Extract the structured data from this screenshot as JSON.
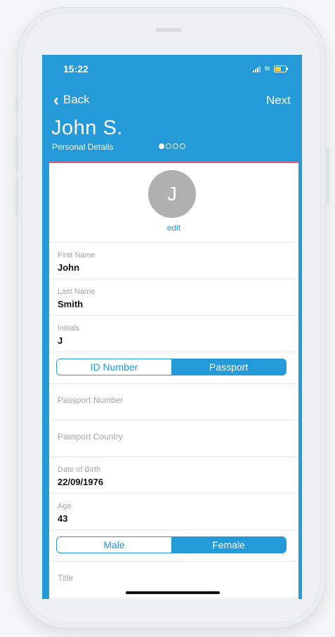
{
  "status": {
    "time": "15:22"
  },
  "nav": {
    "back_label": "Back",
    "next_label": "Next"
  },
  "header": {
    "title": "John S.",
    "subtitle": "Personal Details",
    "step_index": 1,
    "step_count": 4
  },
  "avatar": {
    "initial": "J",
    "edit_label": "edit"
  },
  "fields": {
    "first_name": {
      "label": "First Name",
      "value": "John"
    },
    "last_name": {
      "label": "Last Name",
      "value": "Smith"
    },
    "initials": {
      "label": "Initials",
      "value": "J"
    },
    "passport_number": {
      "label": "Passport Number",
      "value": ""
    },
    "passport_country": {
      "label": "Passport Country",
      "value": ""
    },
    "date_of_birth": {
      "label": "Date of Birth",
      "value": "22/09/1976"
    },
    "age": {
      "label": "Age",
      "value": "43"
    },
    "title": {
      "label": "Title",
      "value": ""
    }
  },
  "id_type": {
    "options": [
      "ID Number",
      "Passport"
    ],
    "selected": "Passport"
  },
  "gender": {
    "options": [
      "Male",
      "Female"
    ],
    "selected": "Female"
  },
  "colors": {
    "primary": "#259ad9",
    "accent_line": "#e85a7a",
    "avatar_bg": "#b0b0b0"
  }
}
